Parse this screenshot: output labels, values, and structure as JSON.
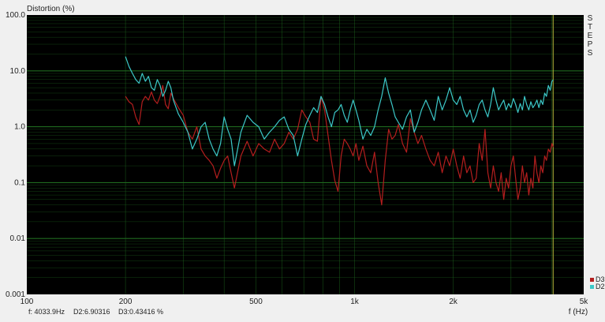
{
  "chart_data": {
    "type": "line",
    "ylabel": "Distortion (%)",
    "xlabel": "f (Hz)",
    "x_scale": "log",
    "y_scale": "log",
    "xlim": [
      100,
      5000
    ],
    "ylim": [
      0.001,
      100
    ],
    "x_ticks": [
      {
        "value": 100,
        "label": "100"
      },
      {
        "value": 200,
        "label": "200"
      },
      {
        "value": 500,
        "label": "500"
      },
      {
        "value": 1000,
        "label": "1k"
      },
      {
        "value": 2000,
        "label": "2k"
      },
      {
        "value": 5000,
        "label": "5k"
      }
    ],
    "y_ticks": [
      {
        "value": 100,
        "label": "100.0"
      },
      {
        "value": 10,
        "label": "10.0"
      },
      {
        "value": 1,
        "label": "1.0"
      },
      {
        "value": 0.1,
        "label": "0.1"
      },
      {
        "value": 0.01,
        "label": "0.01"
      },
      {
        "value": 0.001,
        "label": "0.001"
      }
    ],
    "grid": true,
    "background": "#000000",
    "grid_color": "#1f6b1f",
    "cursor_x": 4033.9,
    "cursor_color": "#b8b83a",
    "legend_position": "bottom-right",
    "side_label": "STEPS",
    "series": [
      {
        "name": "D3",
        "color": "#b41e1e",
        "x": [
          200,
          205,
          210,
          215,
          220,
          225,
          230,
          235,
          240,
          245,
          250,
          255,
          260,
          265,
          270,
          275,
          280,
          290,
          300,
          310,
          320,
          330,
          340,
          350,
          360,
          370,
          380,
          390,
          400,
          410,
          420,
          430,
          450,
          470,
          490,
          510,
          530,
          550,
          570,
          590,
          610,
          630,
          650,
          670,
          690,
          710,
          730,
          750,
          770,
          790,
          810,
          830,
          850,
          870,
          890,
          910,
          930,
          950,
          970,
          990,
          1010,
          1030,
          1060,
          1090,
          1120,
          1150,
          1180,
          1210,
          1240,
          1270,
          1300,
          1330,
          1360,
          1400,
          1440,
          1480,
          1520,
          1560,
          1600,
          1650,
          1700,
          1750,
          1800,
          1850,
          1900,
          1950,
          2000,
          2050,
          2100,
          2150,
          2200,
          2250,
          2300,
          2350,
          2400,
          2450,
          2500,
          2550,
          2600,
          2650,
          2700,
          2750,
          2800,
          2850,
          2900,
          2950,
          3000,
          3050,
          3100,
          3150,
          3200,
          3250,
          3300,
          3350,
          3400,
          3450,
          3500,
          3550,
          3600,
          3650,
          3700,
          3750,
          3800,
          3850,
          3900,
          3950,
          4000,
          4033.9
        ],
        "values": [
          3.5,
          2.8,
          2.5,
          1.5,
          1.1,
          2.8,
          3.5,
          3.0,
          4.2,
          3.0,
          2.6,
          3.5,
          5.5,
          2.5,
          2.1,
          4.0,
          3.2,
          2.2,
          1.6,
          0.8,
          0.6,
          1.0,
          0.4,
          0.3,
          0.25,
          0.2,
          0.12,
          0.18,
          0.25,
          0.3,
          0.15,
          0.08,
          0.3,
          0.55,
          0.3,
          0.5,
          0.4,
          0.35,
          0.6,
          0.4,
          0.5,
          0.8,
          0.6,
          0.9,
          2.0,
          1.5,
          1.2,
          0.6,
          0.55,
          3.5,
          2.0,
          0.7,
          0.25,
          0.11,
          0.07,
          0.3,
          0.6,
          0.5,
          0.4,
          0.3,
          0.5,
          0.25,
          0.45,
          0.2,
          0.15,
          0.35,
          0.1,
          0.04,
          0.25,
          0.9,
          0.6,
          0.7,
          1.1,
          0.5,
          0.35,
          1.4,
          0.8,
          0.5,
          0.7,
          0.4,
          0.25,
          0.2,
          0.35,
          0.15,
          0.3,
          0.2,
          0.4,
          0.2,
          0.12,
          0.3,
          0.15,
          0.2,
          0.1,
          0.12,
          0.5,
          0.25,
          0.9,
          0.15,
          0.08,
          0.2,
          0.1,
          0.07,
          0.15,
          0.05,
          0.12,
          0.08,
          0.2,
          0.3,
          0.12,
          0.05,
          0.08,
          0.2,
          0.1,
          0.15,
          0.06,
          0.12,
          0.08,
          0.3,
          0.15,
          0.1,
          0.2,
          0.15,
          0.3,
          0.25,
          0.4,
          0.35,
          0.5,
          0.434
        ]
      },
      {
        "name": "D2",
        "color": "#3cc8c8",
        "x": [
          200,
          205,
          210,
          215,
          220,
          225,
          230,
          235,
          240,
          245,
          250,
          255,
          260,
          265,
          270,
          275,
          280,
          290,
          300,
          310,
          320,
          330,
          340,
          350,
          360,
          370,
          380,
          390,
          400,
          410,
          420,
          430,
          450,
          470,
          490,
          510,
          530,
          550,
          570,
          590,
          610,
          630,
          650,
          670,
          690,
          710,
          730,
          750,
          770,
          790,
          810,
          830,
          850,
          870,
          890,
          910,
          930,
          950,
          970,
          990,
          1010,
          1030,
          1060,
          1090,
          1120,
          1150,
          1180,
          1210,
          1240,
          1270,
          1300,
          1330,
          1360,
          1400,
          1440,
          1480,
          1520,
          1560,
          1600,
          1650,
          1700,
          1750,
          1800,
          1850,
          1900,
          1950,
          2000,
          2050,
          2100,
          2150,
          2200,
          2250,
          2300,
          2350,
          2400,
          2450,
          2500,
          2550,
          2600,
          2650,
          2700,
          2750,
          2800,
          2850,
          2900,
          2950,
          3000,
          3050,
          3100,
          3150,
          3200,
          3250,
          3300,
          3350,
          3400,
          3450,
          3500,
          3550,
          3600,
          3650,
          3700,
          3750,
          3800,
          3850,
          3900,
          3950,
          4000,
          4033.9
        ],
        "values": [
          18,
          12,
          9,
          7,
          6,
          9,
          6.5,
          8,
          5,
          4.5,
          7,
          5.5,
          3.5,
          4.5,
          6.5,
          5,
          3,
          1.7,
          1.2,
          0.8,
          0.4,
          0.6,
          1.0,
          1.2,
          0.6,
          0.4,
          0.3,
          0.5,
          1.5,
          0.9,
          0.6,
          0.2,
          0.8,
          1.6,
          1.2,
          1.0,
          0.6,
          0.8,
          1.0,
          1.3,
          1.5,
          0.9,
          0.7,
          0.3,
          0.6,
          1.1,
          1.6,
          2.2,
          1.8,
          3.5,
          2.5,
          1.5,
          1.0,
          1.8,
          2.0,
          2.5,
          1.6,
          1.2,
          2.0,
          3.0,
          2.0,
          1.3,
          0.6,
          0.9,
          0.7,
          1.0,
          2.0,
          3.5,
          7.5,
          4.0,
          2.5,
          1.5,
          1.2,
          0.9,
          1.5,
          2.0,
          0.8,
          1.2,
          2.0,
          3.0,
          2.0,
          1.3,
          3.5,
          2.0,
          3.0,
          5.0,
          3.0,
          2.5,
          3.5,
          2.0,
          1.5,
          2.0,
          1.2,
          1.6,
          2.5,
          3.0,
          2.0,
          1.5,
          2.5,
          5.0,
          3.0,
          2.0,
          2.5,
          3.0,
          2.0,
          2.6,
          2.2,
          3.2,
          2.5,
          1.8,
          2.6,
          2.0,
          3.5,
          2.5,
          2.0,
          2.8,
          2.2,
          2.5,
          3.0,
          2.2,
          3.0,
          2.5,
          4.0,
          3.5,
          5.5,
          4.5,
          6.5,
          6.9
        ]
      }
    ]
  },
  "status_bar": {
    "frequency": "f: 4033.9Hz",
    "d2": "D2:6.90316",
    "d3": "D3:0.43416 %"
  }
}
